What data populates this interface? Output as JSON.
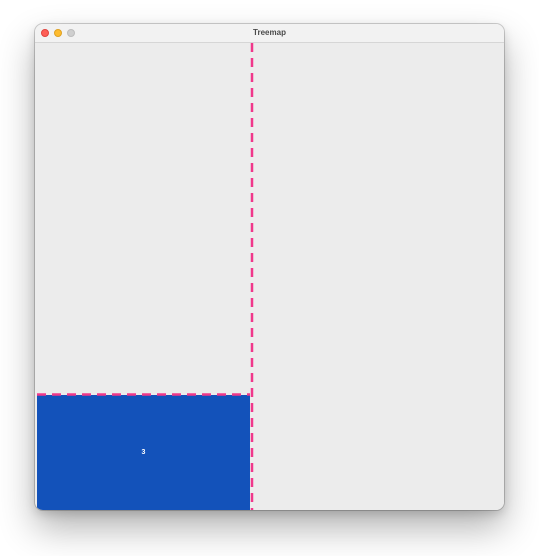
{
  "window": {
    "title": "Treemap"
  },
  "treemap": {
    "tiles": [
      {
        "label": "3",
        "color": "#1352ba"
      }
    ],
    "split_line_color": "#f0388a"
  }
}
